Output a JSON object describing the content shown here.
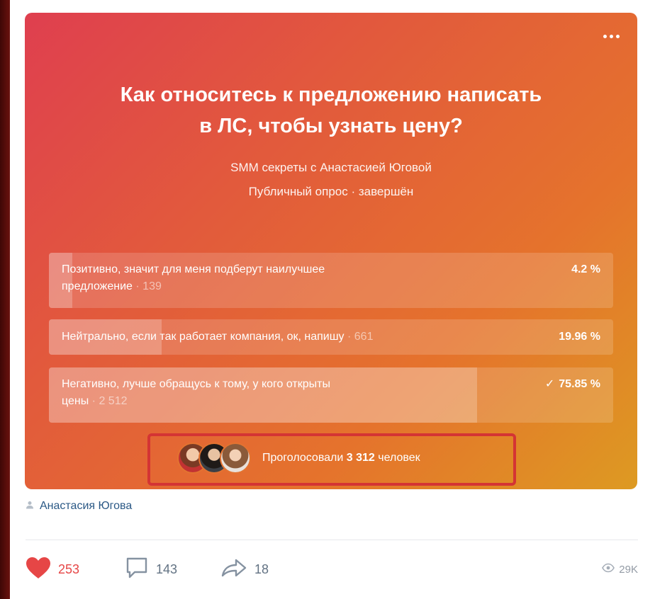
{
  "poll": {
    "question_line1": "Как относитесь к предложению написать",
    "question_line2": "в ЛС, чтобы узнать цену?",
    "author": "SMM секреты с Анастасией Юговой",
    "status": "Публичный опрос · завершён",
    "options": [
      {
        "text_line1": "Позитивно, значит для меня подберут наилучшее",
        "text_line2": "предложение",
        "count": "· 139",
        "percent": "4.2 %",
        "share": 0.042,
        "checked": false
      },
      {
        "text_line1": "Нейтрально, если так работает компания, ок, напишу",
        "text_line2": "",
        "count": "· 661",
        "percent": "19.96 %",
        "share": 0.1996,
        "checked": false
      },
      {
        "text_line1": "Негативно, лучше обращусь к тому, у кого открыты",
        "text_line2": "цены",
        "count": "· 2 512",
        "percent": "75.85 %",
        "share": 0.7585,
        "checked": true,
        "check_glyph": "✓"
      }
    ],
    "voters": {
      "prefix": "Проголосовали",
      "count": "3 312",
      "suffix": "человек"
    }
  },
  "post": {
    "author_name": "Анастасия Югова",
    "likes": "253",
    "comments": "143",
    "shares": "18",
    "views": "29K"
  },
  "colors": {
    "accent_like": "#e64646",
    "link": "#2a5885",
    "highlight_box": "#d43434"
  },
  "icons": [
    "more-icon",
    "person-icon",
    "heart-icon",
    "comment-icon",
    "share-icon",
    "eye-icon",
    "check-icon"
  ]
}
